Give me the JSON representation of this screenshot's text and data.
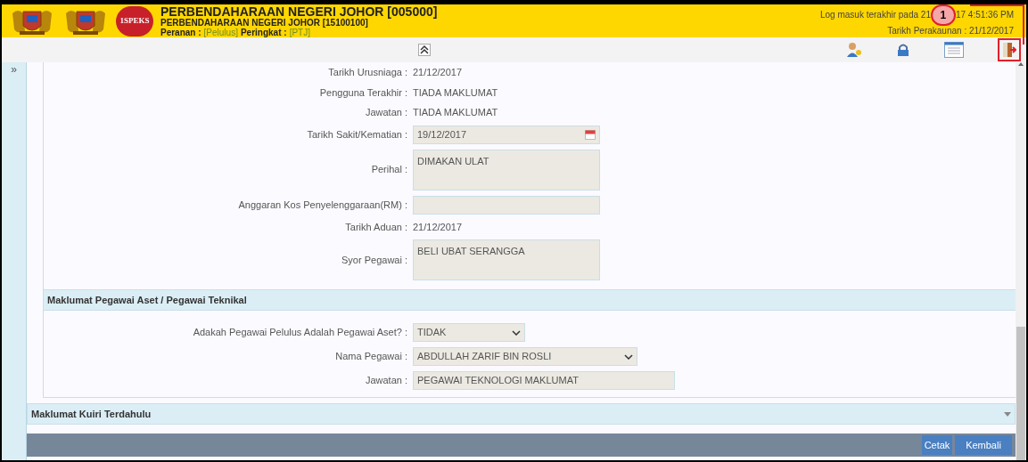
{
  "header": {
    "badge_logo_text": "1SPEKS",
    "title": "PERBENDAHARAAN NEGERI JOHOR [005000]",
    "subtitle": "PERBENDAHARAAN NEGERI JOHOR [15100100]",
    "role_label": "Peranan :",
    "role_value": "[Pelulus]",
    "level_label": "Peringkat :",
    "level_value": "[PTJ]",
    "last_login_start": "Log masuk terakhir pada 21",
    "last_login_end": "17 4:51:36 PM",
    "accounting_date": "Tarikh Perakaunan : 21/12/2017"
  },
  "annotation": {
    "marker": "1"
  },
  "sidebar": {
    "toggle": "»"
  },
  "form": [
    {
      "kind": "text",
      "label": "Tarikh Urusniaga :",
      "value": "21/12/2017"
    },
    {
      "kind": "text",
      "label": "Pengguna Terakhir :",
      "value": "TIADA MAKLUMAT"
    },
    {
      "kind": "text",
      "label": "Jawatan :",
      "value": "TIADA MAKLUMAT"
    },
    {
      "kind": "date",
      "label": "Tarikh Sakit/Kematian :",
      "value": "19/12/2017"
    },
    {
      "kind": "textarea",
      "label": "Perihal :",
      "value": "DIMAKAN ULAT"
    },
    {
      "kind": "input",
      "label": "Anggaran Kos Penyelenggaraan(RM) :"
    },
    {
      "kind": "text",
      "label": "Tarikh Aduan :",
      "value": "21/12/2017"
    },
    {
      "kind": "textarea",
      "label": "Syor Pegawai :",
      "value": "BELI UBAT SERANGGA"
    }
  ],
  "section": {
    "title": "Maklumat Pegawai Aset / Pegawai Teknikal",
    "fields": [
      {
        "kind": "select",
        "label": "Adakah Pegawai Pelulus Adalah Pegawai Aset? :",
        "value": "TIDAK"
      },
      {
        "kind": "select",
        "label": "Nama Pegawai :",
        "value": "ABDULLAH ZARIF BIN ROSLI"
      },
      {
        "kind": "input",
        "label": "Jawatan :",
        "value": "PEGAWAI TEKNOLOGI MAKLUMAT"
      }
    ]
  },
  "collapsed_section": {
    "title": "Maklumat Kuiri Terdahulu",
    "expanded": false
  },
  "buttons": [
    "Cetak",
    "Kembali"
  ]
}
